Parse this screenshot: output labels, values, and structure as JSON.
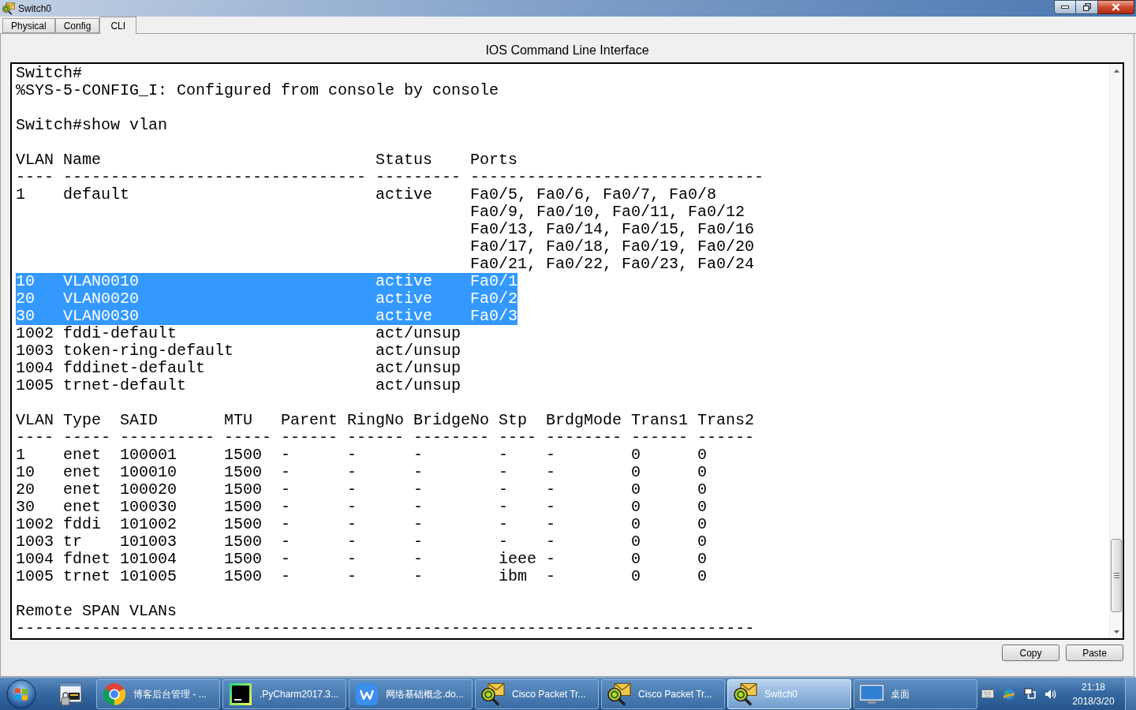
{
  "window": {
    "title": "Switch0"
  },
  "tabs": [
    {
      "label": "Physical",
      "selected": false
    },
    {
      "label": "Config",
      "selected": false
    },
    {
      "label": "CLI",
      "selected": true
    }
  ],
  "panel": {
    "title": "IOS Command Line Interface"
  },
  "terminal": {
    "blocks": [
      {
        "kind": "lines",
        "lines": [
          "Switch#",
          "%SYS-5-CONFIG_I: Configured from console by console"
        ]
      },
      {
        "kind": "lines",
        "lines": [
          "Switch#show vlan"
        ]
      },
      {
        "kind": "brief_table",
        "columns": [
          "VLAN",
          "Name",
          "Status",
          "Ports"
        ],
        "separators": [
          "----",
          "--------------------------------",
          "---------",
          "-------------------------------"
        ],
        "rows": [
          {
            "vlan": "1",
            "name": "default",
            "status": "active",
            "ports": [
              "Fa0/5, Fa0/6, Fa0/7, Fa0/8",
              "Fa0/9, Fa0/10, Fa0/11, Fa0/12",
              "Fa0/13, Fa0/14, Fa0/15, Fa0/16",
              "Fa0/17, Fa0/18, Fa0/19, Fa0/20",
              "Fa0/21, Fa0/22, Fa0/23, Fa0/24"
            ],
            "selected": false
          },
          {
            "vlan": "10",
            "name": "VLAN0010",
            "status": "active",
            "ports": [
              "Fa0/1"
            ],
            "selected": true
          },
          {
            "vlan": "20",
            "name": "VLAN0020",
            "status": "active",
            "ports": [
              "Fa0/2"
            ],
            "selected": true
          },
          {
            "vlan": "30",
            "name": "VLAN0030",
            "status": "active",
            "ports": [
              "Fa0/3"
            ],
            "selected": true
          },
          {
            "vlan": "1002",
            "name": "fddi-default",
            "status": "act/unsup",
            "selected": false
          },
          {
            "vlan": "1003",
            "name": "token-ring-default",
            "status": "act/unsup",
            "selected": false
          },
          {
            "vlan": "1004",
            "name": "fddinet-default",
            "status": "act/unsup",
            "selected": false
          },
          {
            "vlan": "1005",
            "name": "trnet-default",
            "status": "act/unsup",
            "selected": false
          }
        ]
      },
      {
        "kind": "detail_table",
        "columns": [
          "VLAN",
          "Type",
          "SAID",
          "MTU",
          "Parent",
          "RingNo",
          "BridgeNo",
          "Stp",
          "BrdgMode",
          "Trans1",
          "Trans2"
        ],
        "separators": [
          "----",
          "-----",
          "----------",
          "-----",
          "------",
          "------",
          "--------",
          "----",
          "--------",
          "------",
          "------"
        ],
        "rows": [
          {
            "cells": [
              "1",
              "enet",
              "100001",
              "1500",
              "-",
              "-",
              "-",
              "-",
              "-",
              "0",
              "0"
            ]
          },
          {
            "cells": [
              "10",
              "enet",
              "100010",
              "1500",
              "-",
              "-",
              "-",
              "-",
              "-",
              "0",
              "0"
            ]
          },
          {
            "cells": [
              "20",
              "enet",
              "100020",
              "1500",
              "-",
              "-",
              "-",
              "-",
              "-",
              "0",
              "0"
            ]
          },
          {
            "cells": [
              "30",
              "enet",
              "100030",
              "1500",
              "-",
              "-",
              "-",
              "-",
              "-",
              "0",
              "0"
            ]
          },
          {
            "cells": [
              "1002",
              "fddi",
              "101002",
              "1500",
              "-",
              "-",
              "-",
              "-",
              "-",
              "0",
              "0"
            ]
          },
          {
            "cells": [
              "1003",
              "tr",
              "101003",
              "1500",
              "-",
              "-",
              "-",
              "-",
              "-",
              "0",
              "0"
            ]
          },
          {
            "cells": [
              "1004",
              "fdnet",
              "101004",
              "1500",
              "-",
              "-",
              "-",
              "ieee",
              "-",
              "0",
              "0"
            ]
          },
          {
            "cells": [
              "1005",
              "trnet",
              "101005",
              "1500",
              "-",
              "-",
              "-",
              "ibm",
              "-",
              "0",
              "0"
            ]
          }
        ]
      },
      {
        "kind": "lines",
        "lines": [
          "Remote SPAN VLANs",
          "------------------------------------------------------------------------------"
        ]
      }
    ]
  },
  "buttons": [
    "Copy",
    "Paste"
  ],
  "taskbar": {
    "items": [
      {
        "kind": "browser",
        "label": "博客后台管理 - ...",
        "selected": false
      },
      {
        "kind": "ide",
        "label": ".PyCharm2017.3...",
        "selected": false
      },
      {
        "kind": "writer",
        "label": "网络基础概念.do...",
        "selected": false
      },
      {
        "kind": "packet_tracer",
        "label": "Cisco Packet Tr...",
        "selected": false
      },
      {
        "kind": "packet_tracer",
        "label": "Cisco Packet Tr...",
        "selected": false
      },
      {
        "kind": "packet_tracer",
        "label": "Switch0",
        "selected": true
      },
      {
        "kind": "desktop",
        "label": "桌面",
        "selected": false
      }
    ],
    "clock": {
      "time": "21:18",
      "date": "2018/3/20"
    }
  }
}
